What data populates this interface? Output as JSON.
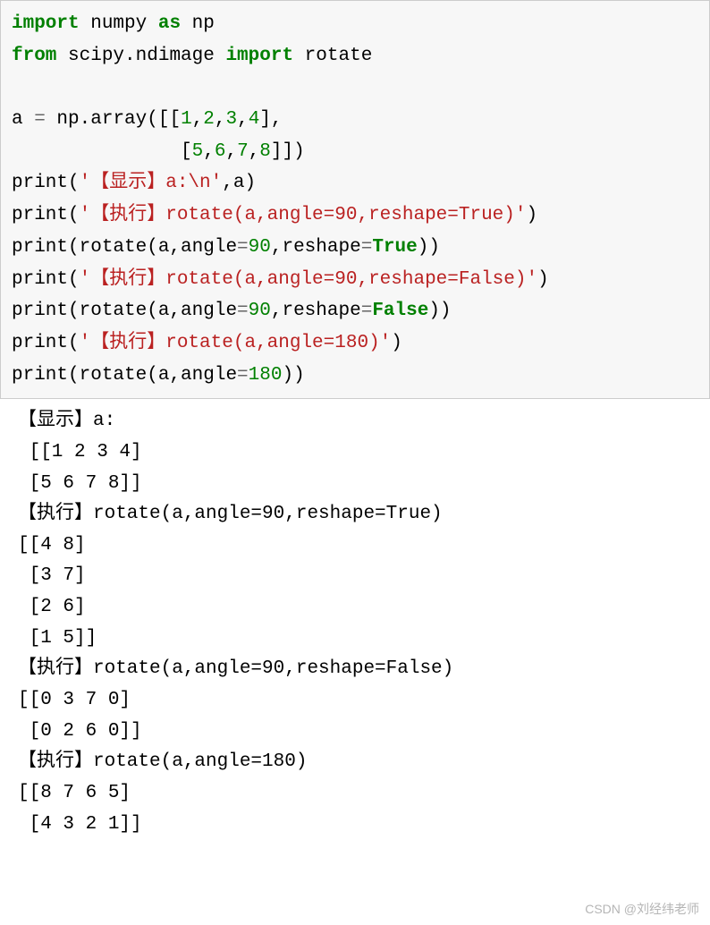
{
  "code": {
    "import_kw": "import",
    "numpy": " numpy ",
    "as_kw": "as",
    "np_alias": " np",
    "from_kw": "from",
    "scipy_mod": " scipy.ndimage ",
    "import_kw2": "import",
    "rotate_name": " rotate",
    "a_var": "a ",
    "eq": "=",
    "np_array": " np.array([[",
    "n1": "1",
    "c": ",",
    "n2": "2",
    "n3": "3",
    "n4": "4",
    "row_end": "],",
    "indent2": "               [",
    "n5": "5",
    "n6": "6",
    "n7": "7",
    "n8": "8",
    "arr_end": "]])",
    "print": "print",
    "lp": "(",
    "rp": ")",
    "str1": "'【显示】a:\\n'",
    "comma_a": ",a)",
    "str2": "'【执行】rotate(a,angle=90,reshape=True)'",
    "call2a": "(rotate(a,angle",
    "eq2": "=",
    "n90": "90",
    "reshape_part": ",reshape",
    "true_v": "True",
    "rp2": "))",
    "str3": "'【执行】rotate(a,angle=90,reshape=False)'",
    "false_v": "False",
    "str4": "'【执行】rotate(a,angle=180)'",
    "n180": "180",
    "call4": "(rotate(a,angle",
    "rp4": "))"
  },
  "output": {
    "l1": "【显示】a:",
    "l2": " [[1 2 3 4]",
    "l3": " [5 6 7 8]]",
    "l4": "【执行】rotate(a,angle=90,reshape=True)",
    "l5": "[[4 8]",
    "l6": " [3 7]",
    "l7": " [2 6]",
    "l8": " [1 5]]",
    "l9": "【执行】rotate(a,angle=90,reshape=False)",
    "l10": "[[0 3 7 0]",
    "l11": " [0 2 6 0]]",
    "l12": "【执行】rotate(a,angle=180)",
    "l13": "[[8 7 6 5]",
    "l14": " [4 3 2 1]]"
  },
  "watermark": "CSDN @刘经纬老师"
}
